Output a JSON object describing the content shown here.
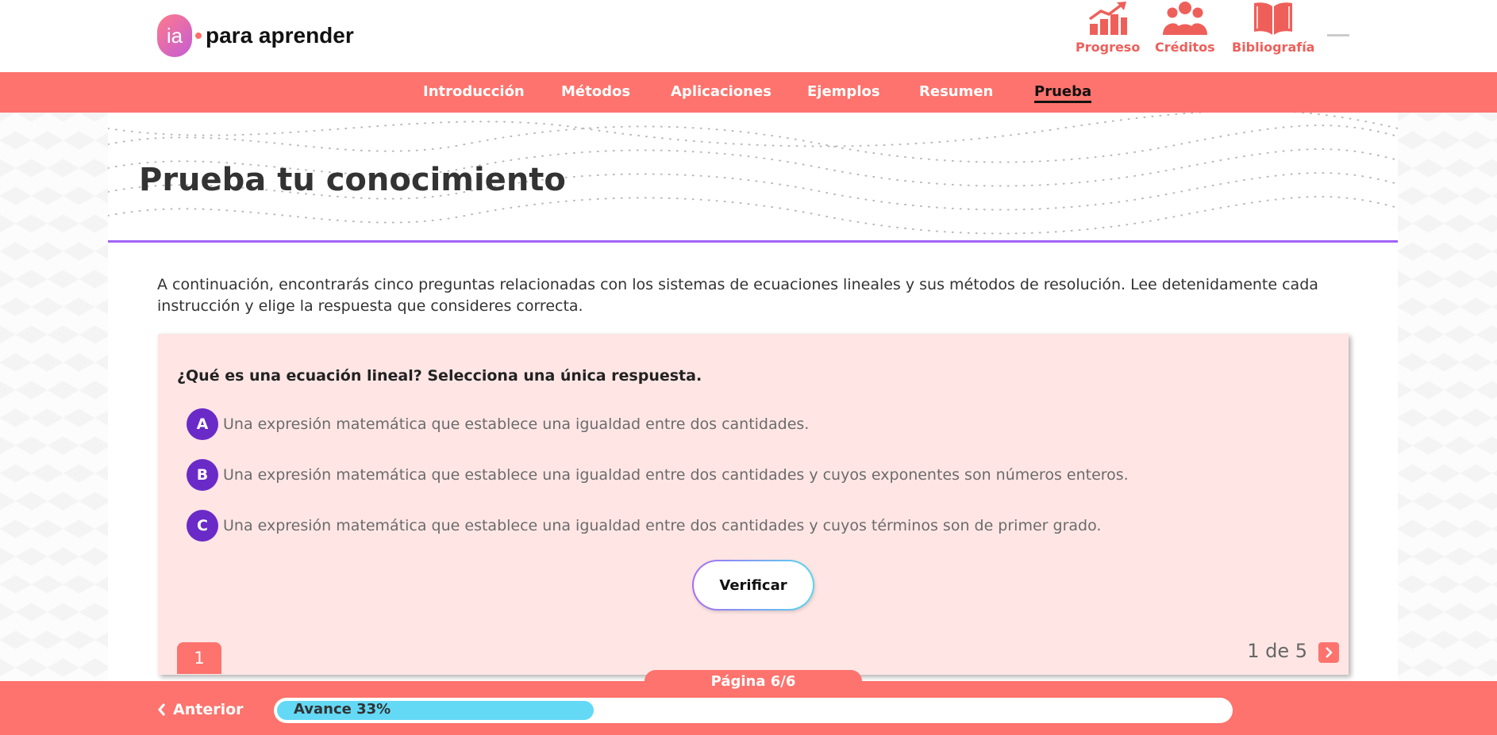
{
  "brand": {
    "logo_mark": "ia",
    "name": "para aprender"
  },
  "top_icons": [
    {
      "label": "Progreso",
      "icon": "chart-up-icon"
    },
    {
      "label": "Créditos",
      "icon": "people-icon"
    },
    {
      "label": "Bibliografía",
      "icon": "book-icon"
    }
  ],
  "nav": {
    "items": [
      "Introducción",
      "Métodos",
      "Aplicaciones",
      "Ejemplos",
      "Resumen",
      "Prueba"
    ],
    "active": "Prueba"
  },
  "page_title": "Prueba tu conocimiento",
  "intro": "A continuación, encontrarás cinco preguntas relacionadas con los sistemas de ecuaciones lineales y sus métodos de resolución. Lee detenidamente cada instrucción y elige la respuesta que consideres correcta.",
  "quiz": {
    "question": "¿Qué es una ecuación lineal? Selecciona una única respuesta.",
    "options": [
      {
        "letter": "A",
        "text": "Una expresión matemática que establece una igualdad entre dos cantidades."
      },
      {
        "letter": "B",
        "text": "Una expresión matemática que establece una igualdad entre dos cantidades y cuyos exponentes son números enteros."
      },
      {
        "letter": "C",
        "text": "Una expresión matemática que establece una igualdad entre dos cantidades y cuyos términos son de primer grado."
      }
    ],
    "verify_label": "Verificar",
    "badge": "1",
    "counter": "1 de 5"
  },
  "footer": {
    "page_label": "Página 6/6",
    "prev_label": "Anterior",
    "progress_label": "Avance 33%",
    "progress_fraction": 0.33
  },
  "colors": {
    "coral": "#fe736d",
    "purple": "#6a2ac7",
    "accent_line": "#a163f7",
    "progress": "#63d9f6",
    "card_bg": "#ffe6e5"
  }
}
